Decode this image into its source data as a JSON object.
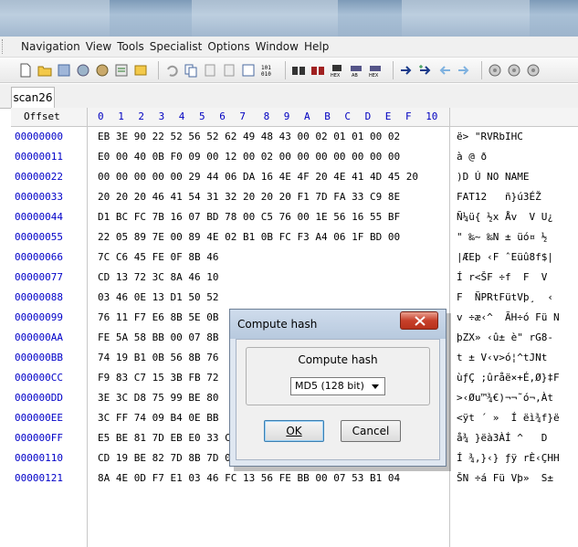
{
  "menu": [
    "Navigation",
    "View",
    "Tools",
    "Specialist",
    "Options",
    "Window",
    "Help"
  ],
  "tab": {
    "label": "scan26"
  },
  "grid_header": {
    "offset": "Offset",
    "columns": [
      "0",
      "1",
      "2",
      "3",
      "4",
      "5",
      "6",
      "7",
      "8",
      "9",
      "A",
      "B",
      "C",
      "D",
      "E",
      "F",
      "10"
    ]
  },
  "rows": [
    {
      "offset": "00000000",
      "hex": "EB 3E 90 22 52 56 52 62 49 48 43 00 02 01 01 00 02",
      "ascii": "ë> \"RVRbIHC"
    },
    {
      "offset": "00000011",
      "hex": "E0 00 40 0B F0 09 00 12 00 02 00 00 00 00 00 00 00",
      "ascii": "à @ ð"
    },
    {
      "offset": "00000022",
      "hex": "00 00 00 00 00 29 44 06 DA 16 4E 4F 20 4E 41 4D 45 20",
      "ascii": ")D Ú NO NAME"
    },
    {
      "offset": "00000033",
      "hex": "20 20 20 46 41 54 31 32 20 20 20 F1 7D FA 33 C9 8E",
      "ascii": "FAT12   ñ}ú3ÉŽ"
    },
    {
      "offset": "00000044",
      "hex": "D1 BC FC 7B 16 07 BD 78 00 C5 76 00 1E 56 16 55 BF",
      "ascii": "Ñ¼ü{ ½x Åv  V U¿"
    },
    {
      "offset": "00000055",
      "hex": "22 05 89 7E 00 89 4E 02 B1 0B FC F3 A4 06 1F BD 00",
      "ascii": "\" ‰~ ‰N ± üó¤ ½"
    },
    {
      "offset": "00000066",
      "hex": "7C C6 45 FE 0F 8B 46 ",
      "ascii": "|ÆEþ ‹F ˆEüû8f$|"
    },
    {
      "offset": "00000077",
      "hex": "CD 13 72 3C 8A 46 10 ",
      "ascii": "Í r<ŠF ÷f  F  V"
    },
    {
      "offset": "00000088",
      "hex": "03 46 0E 13 D1 50 52 ",
      "ascii": "F  ÑPRtFütVþ¸  ‹"
    },
    {
      "offset": "00000099",
      "hex": "76 11 F7 E6 8B 5E 0B ",
      "ascii": "v ÷æ‹^  ÃH÷ó Fü N"
    },
    {
      "offset": "000000AA",
      "hex": "FE 5A 58 BB 00 07 8B ",
      "ascii": "þZX» ‹û± è\" rG8-"
    },
    {
      "offset": "000000BB",
      "hex": "74 19 B1 0B 56 8B 76 ",
      "ascii": "t ± V‹v>ó¦^tJNt"
    },
    {
      "offset": "000000CC",
      "hex": "F9 83 C7 15 3B FB 72 ",
      "ascii": "ùƒÇ ;ûråë×+É,Ø}‡F"
    },
    {
      "offset": "000000DD",
      "hex": "3E 3C D8 75 99 BE 80 ",
      "ascii": ">‹Øu™¾€)¬¬˜ó¬,Àt"
    },
    {
      "offset": "000000EE",
      "hex": "3C FF 74 09 B4 0E BB ",
      "ascii": "<ÿt ´ »  Í ëì¾f}ë"
    },
    {
      "offset": "000000FF",
      "hex": "E5 BE 81 7D EB E0 33 C0 CD 16 5E 1F 8F 04 8F 44 02",
      "ascii": "å¾ }ëà3ÀÍ ^   D"
    },
    {
      "offset": "00000110",
      "hex": "CD 19 BE 82 7D 8B 7D 0F 83 FF 02 72 C8 8B C7 48 48",
      "ascii": "Í ¾‚}‹} ƒÿ rÈ‹ÇHH"
    },
    {
      "offset": "00000121",
      "hex": "8A 4E 0D F7 E1 03 46 FC 13 56 FE BB 00 07 53 B1 04",
      "ascii": "ŠN ÷á Fü Vþ»  S±"
    }
  ],
  "dialog": {
    "title": "Compute hash",
    "group_label": "Compute hash",
    "select_value": "MD5 (128 bit)",
    "ok_label": "OK",
    "cancel_label": "Cancel"
  },
  "colors": {
    "offset_blue": "#0000c8",
    "header_blue": "#0000c0",
    "close_red": "#c7402a"
  },
  "toolbar_icons": [
    "new-file-icon",
    "open-folder-icon",
    "save-icon",
    "disk-icon",
    "disk2-icon",
    "properties-icon",
    "window-icon",
    "undo-icon",
    "copy-icon",
    "cut-icon",
    "paste-icon",
    "paste-special-icon",
    "binary-icon",
    "find-icon",
    "find-next-icon",
    "find-hex-icon",
    "replace-icon",
    "replace-hex-icon",
    "goto-icon",
    "goto-offset-icon",
    "back-icon",
    "forward-icon",
    "disk3-icon",
    "disk4-icon",
    "disk5-icon"
  ]
}
